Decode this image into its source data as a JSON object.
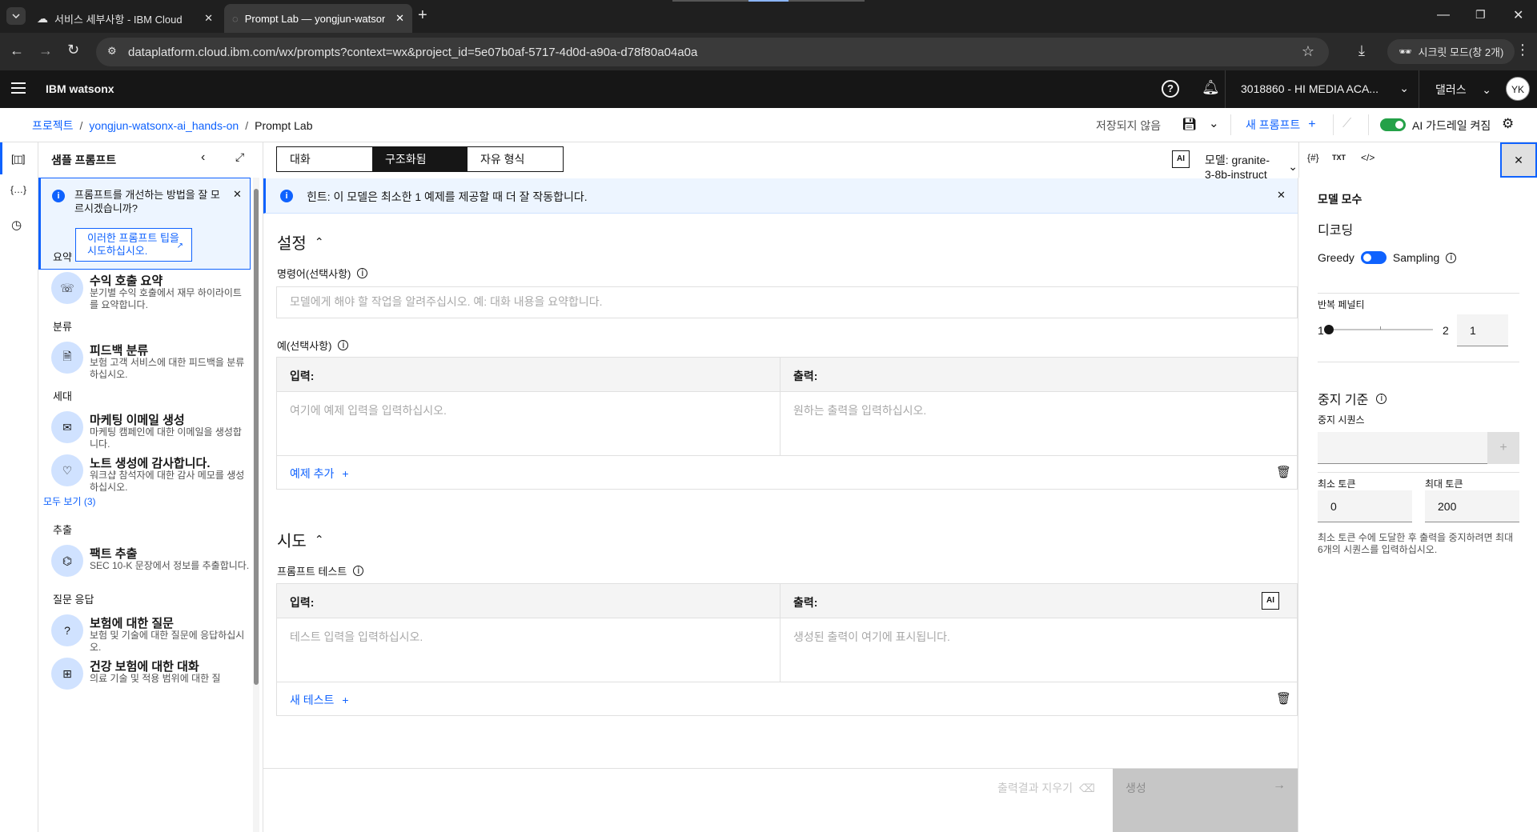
{
  "browser": {
    "tabs": [
      {
        "label": "서비스 세부사항 - IBM Cloud",
        "active": false
      },
      {
        "label": "Prompt Lab — yongjun-watsonx",
        "active": true
      }
    ],
    "url": "dataplatform.cloud.ibm.com/wx/prompts?context=wx&project_id=5e07b0af-5717-4d0d-a90a-d78f80a04a0a",
    "incognito_label": "시크릿 모드(창 2개)"
  },
  "header": {
    "brand": "IBM watsonx",
    "account": "3018860 - HI MEDIA ACA...",
    "region": "댈러스",
    "avatar": "YK"
  },
  "breadcrumb": {
    "items": [
      "프로젝트",
      "yongjun-watsonx-ai_hands-on",
      "Prompt Lab"
    ],
    "unsaved": "저장되지 않음",
    "new_prompt": "새 프롬프트",
    "guardrail": "AI 가드레일 켜짐"
  },
  "sample_panel": {
    "title": "샘플 프롬프트",
    "tip_text": "프롬프트를 개선하는 방법을 잘 모르시겠습니까?",
    "tip_link": "이러한 프롬프트 팁을 시도하십시오.",
    "view_all": "모두 보기 (3)",
    "categories": [
      "요약",
      "분류",
      "세대",
      "추출",
      "질문 응답"
    ],
    "items": [
      {
        "title": "수익 호출 요약",
        "desc": "분기별 수익 호출에서 재무 하이라이트를 요약합니다.",
        "icon": "phone-icon"
      },
      {
        "title": "피드백 분류",
        "desc": "보험 고객 서비스에 대한 피드백을 분류하십시오.",
        "icon": "document-icon"
      },
      {
        "title": "마케팅 이메일 생성",
        "desc": "마케팅 캠페인에 대한 이메일을 생성합니다.",
        "icon": "email-icon"
      },
      {
        "title": "노트 생성에 감사합니다.",
        "desc": "워크샵 참석자에 대한 감사 메모를 생성하십시오.",
        "icon": "person-heart-icon"
      },
      {
        "title": "팩트 추출",
        "desc": "SEC 10-K 문장에서 정보를 추출합니다.",
        "icon": "network-icon"
      },
      {
        "title": "보험에 대한 질문",
        "desc": "보험 및 기술에 대한 질문에 응답하십시오.",
        "icon": "doc-question-icon"
      },
      {
        "title": "건강 보험에 대한 대화",
        "desc": "의료 기술 및 적용 범위에 대한 질",
        "icon": "hospital-icon"
      }
    ]
  },
  "main": {
    "modes": [
      "대화",
      "구조화됨",
      "자유 형식"
    ],
    "active_mode": "구조화됨",
    "ai_badge": "AI",
    "model_label": "모델: granite-3-8b-instruct",
    "hint": "힌트: 이 모델은 최소한 1 예제를 제공할 때 더 잘 작동합니다.",
    "setup_title": "설정",
    "instruction_label": "명령어(선택사항)",
    "instruction_placeholder": "모델에게 해야 할 작업을 알려주십시오. 예: 대화 내용을 요약합니다.",
    "examples_label": "예(선택사항)",
    "input_header": "입력:",
    "output_header": "출력:",
    "example_input_placeholder": "여기에 예제 입력을 입력하십시오.",
    "example_output_placeholder": "원하는 출력을 입력하십시오.",
    "add_example": "예제 추가",
    "try_title": "시도",
    "test_label": "프롬프트 테스트",
    "test_input_placeholder": "테스트 입력을 입력하십시오.",
    "test_output_placeholder": "생성된 출력이 여기에 표시됩니다.",
    "new_test": "새 테스트",
    "clear_output": "출력결과 지우기",
    "generate": "생성"
  },
  "params": {
    "title": "모델 모수",
    "decoding": "디코딩",
    "greedy": "Greedy",
    "sampling": "Sampling",
    "repetition_label": "반복 페널티",
    "rep_min": "1",
    "rep_max": "2",
    "rep_value": "1",
    "rep_fraction": 0.0,
    "stop_title": "중지 기준",
    "stop_seq_label": "중지 시퀀스",
    "min_tokens_label": "최소 토큰",
    "max_tokens_label": "최대 토큰",
    "min_tokens": "0",
    "max_tokens": "200",
    "help": "최소 토큰 수에 도달한 후 출력을 중지하려면 최대 6개의 시퀀스를 입력하십시오."
  },
  "colors": {
    "accent": "#0f62fe",
    "toggle_on": "#24a148",
    "dark": "#161616"
  }
}
